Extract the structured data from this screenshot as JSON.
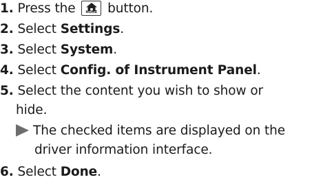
{
  "steps": [
    {
      "num": "1.",
      "pre": "Press the",
      "icon": "home-button-icon",
      "icon_text": "HOME",
      "post": " button."
    },
    {
      "num": "2.",
      "pre": "Select ",
      "bold": "Settings",
      "post": "."
    },
    {
      "num": "3.",
      "pre": "Select ",
      "bold": "System",
      "post": "."
    },
    {
      "num": "4.",
      "pre": "Select ",
      "bold": "Config. of Instrument Panel",
      "post": "."
    },
    {
      "num": "5.",
      "line1": "Select the content you wish to show or",
      "line2": "hide."
    },
    {
      "num": "6.",
      "pre": "Select ",
      "bold": "Done",
      "post": "."
    }
  ],
  "note": {
    "icon": "arrow-right-icon",
    "line1": "The checked items are displayed on the",
    "line2": "driver information interface."
  }
}
